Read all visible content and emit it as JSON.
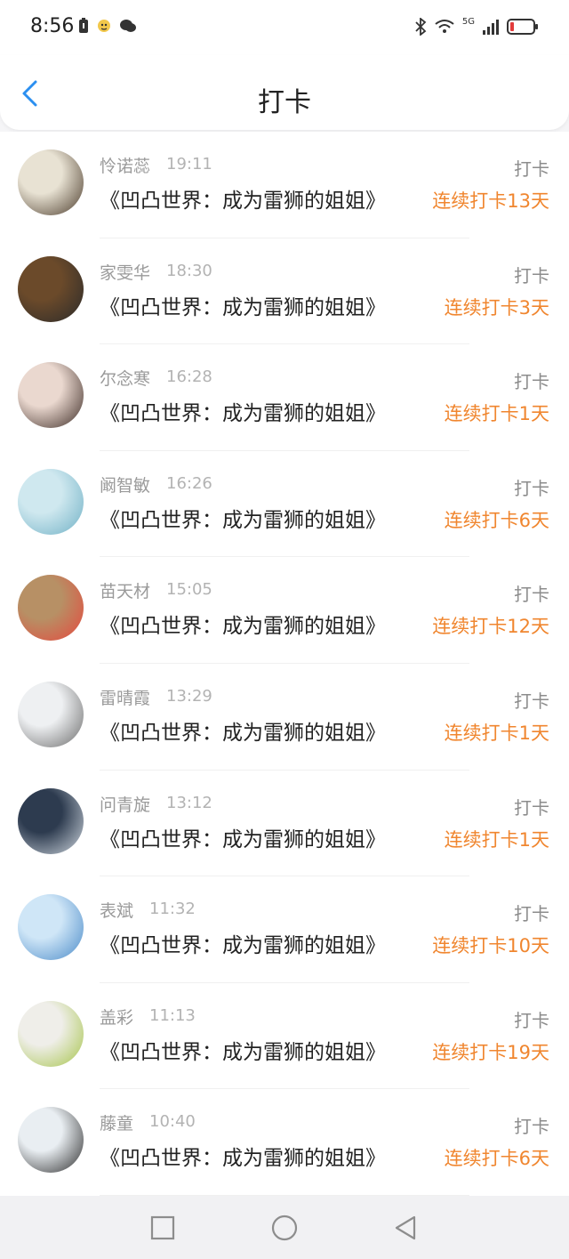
{
  "status": {
    "time": "8:56",
    "network": "5G"
  },
  "nav": {
    "title": "打卡"
  },
  "items": [
    {
      "name": "怜诺蕊",
      "time": "19:11",
      "book": "《凹凸世界：成为雷狮的姐姐》",
      "type": "打卡",
      "streak": "连续打卡13天",
      "avatar_colors": [
        "#e8e2d3",
        "#4a3a2a"
      ]
    },
    {
      "name": "家雯华",
      "time": "18:30",
      "book": "《凹凸世界：成为雷狮的姐姐》",
      "type": "打卡",
      "streak": "连续打卡3天",
      "avatar_colors": [
        "#6b4a2a",
        "#2a2a2a"
      ]
    },
    {
      "name": "尔念寒",
      "time": "16:28",
      "book": "《凹凸世界：成为雷狮的姐姐》",
      "type": "打卡",
      "streak": "连续打卡1天",
      "avatar_colors": [
        "#ead8cf",
        "#3b2a24"
      ]
    },
    {
      "name": "阚智敏",
      "time": "16:26",
      "book": "《凹凸世界：成为雷狮的姐姐》",
      "type": "打卡",
      "streak": "连续打卡6天",
      "avatar_colors": [
        "#cfe8ef",
        "#6fb0c5"
      ]
    },
    {
      "name": "苗天材",
      "time": "15:05",
      "book": "《凹凸世界：成为雷狮的姐姐》",
      "type": "打卡",
      "streak": "连续打卡12天",
      "avatar_colors": [
        "#b79065",
        "#e6483e"
      ]
    },
    {
      "name": "雷晴霞",
      "time": "13:29",
      "book": "《凹凸世界：成为雷狮的姐姐》",
      "type": "打卡",
      "streak": "连续打卡1天",
      "avatar_colors": [
        "#eef0f2",
        "#6a6a6a"
      ]
    },
    {
      "name": "问青旋",
      "time": "13:12",
      "book": "《凹凸世界：成为雷狮的姐姐》",
      "type": "打卡",
      "streak": "连续打卡1天",
      "avatar_colors": [
        "#2d3b4f",
        "#cfd7df"
      ]
    },
    {
      "name": "表斌",
      "time": "11:32",
      "book": "《凹凸世界：成为雷狮的姐姐》",
      "type": "打卡",
      "streak": "连续打卡10天",
      "avatar_colors": [
        "#cfe6f7",
        "#4a8ac8"
      ]
    },
    {
      "name": "盖彩",
      "time": "11:13",
      "book": "《凹凸世界：成为雷狮的姐姐》",
      "type": "打卡",
      "streak": "连续打卡19天",
      "avatar_colors": [
        "#efeee9",
        "#a6c44a"
      ]
    },
    {
      "name": "藤童",
      "time": "10:40",
      "book": "《凹凸世界：成为雷狮的姐姐》",
      "type": "打卡",
      "streak": "连续打卡6天",
      "avatar_colors": [
        "#e9eef2",
        "#2b2b2b"
      ]
    }
  ],
  "colors": {
    "accent": "#2b8ff0",
    "streak": "#f0862f",
    "name": "#9a9a9a",
    "time": "#b3b3b3",
    "text": "#222222"
  },
  "bottom_nav": [
    "square-icon",
    "circle-icon",
    "triangle-back-icon"
  ]
}
